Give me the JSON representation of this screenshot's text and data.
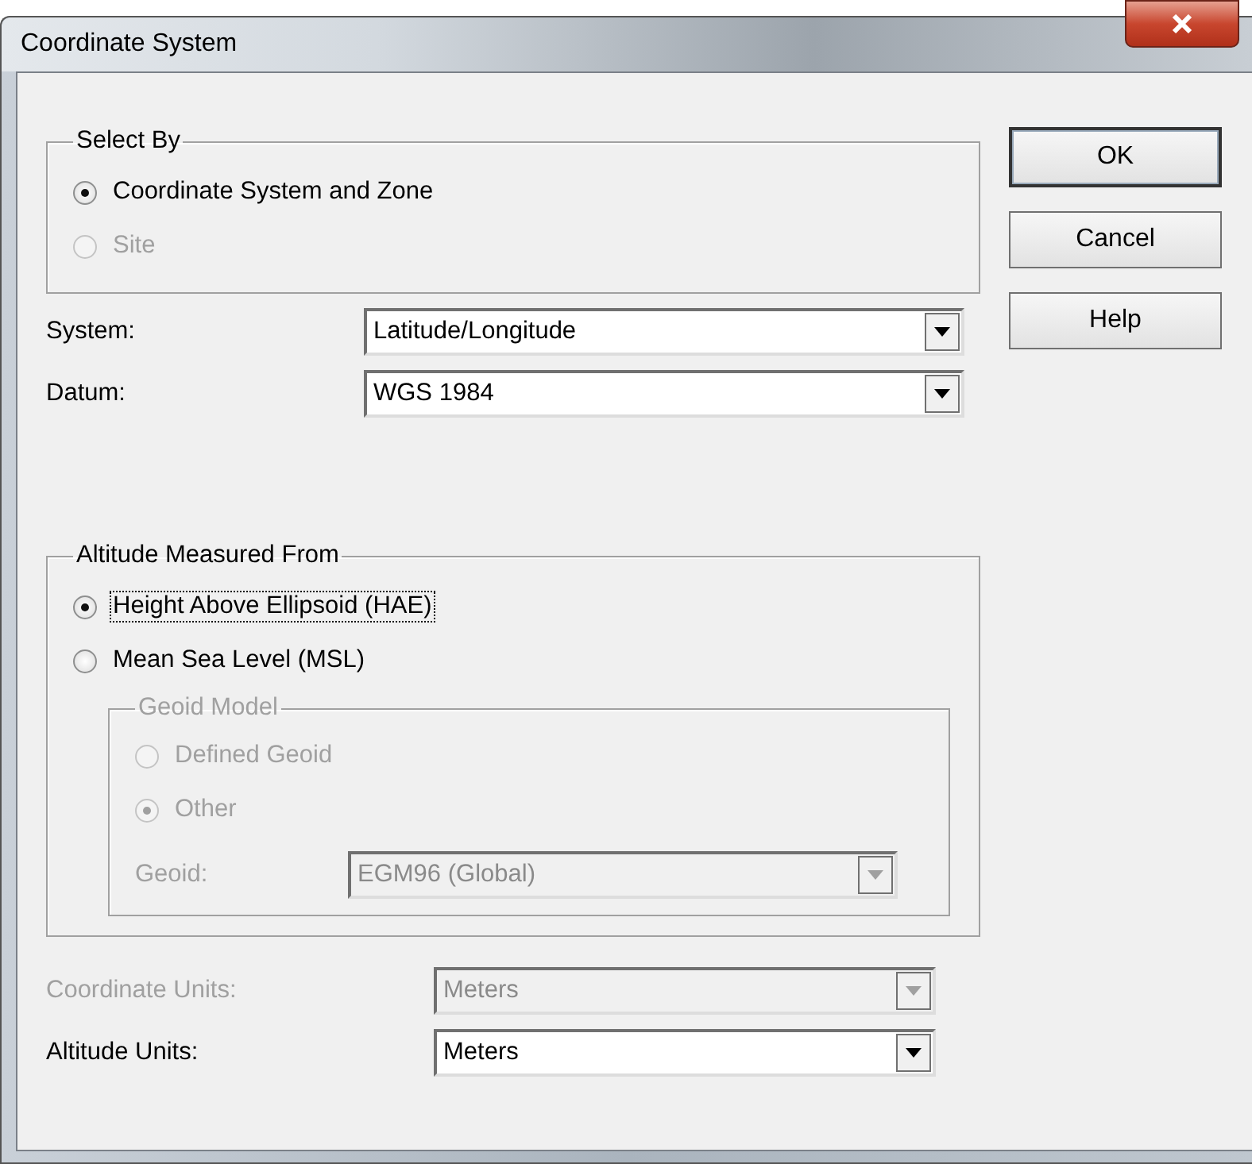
{
  "window": {
    "title": "Coordinate System"
  },
  "select_by": {
    "label": "Select By",
    "options": [
      {
        "label": "Coordinate System and Zone",
        "selected": true,
        "disabled": false
      },
      {
        "label": "Site",
        "selected": false,
        "disabled": true
      }
    ]
  },
  "system": {
    "label": "System:",
    "value": "Latitude/Longitude",
    "disabled": false
  },
  "datum": {
    "label": "Datum:",
    "value": "WGS 1984",
    "disabled": false
  },
  "altitude_measured_from": {
    "label": "Altitude Measured From",
    "options": [
      {
        "label": "Height Above Ellipsoid (HAE)",
        "selected": true,
        "focused": true
      },
      {
        "label": "Mean Sea Level (MSL)",
        "selected": false,
        "focused": false
      }
    ],
    "geoid_model": {
      "label": "Geoid Model",
      "disabled": true,
      "options": [
        {
          "label": "Defined Geoid",
          "selected": false
        },
        {
          "label": "Other",
          "selected": true
        }
      ],
      "geoid": {
        "label": "Geoid:",
        "value": "EGM96 (Global)",
        "disabled": true
      }
    }
  },
  "coordinate_units": {
    "label": "Coordinate Units:",
    "value": "Meters",
    "disabled": true
  },
  "altitude_units": {
    "label": "Altitude Units:",
    "value": "Meters",
    "disabled": false
  },
  "buttons": [
    {
      "label": "OK",
      "default": true
    },
    {
      "label": "Cancel",
      "default": false
    },
    {
      "label": "Help",
      "default": false
    }
  ]
}
